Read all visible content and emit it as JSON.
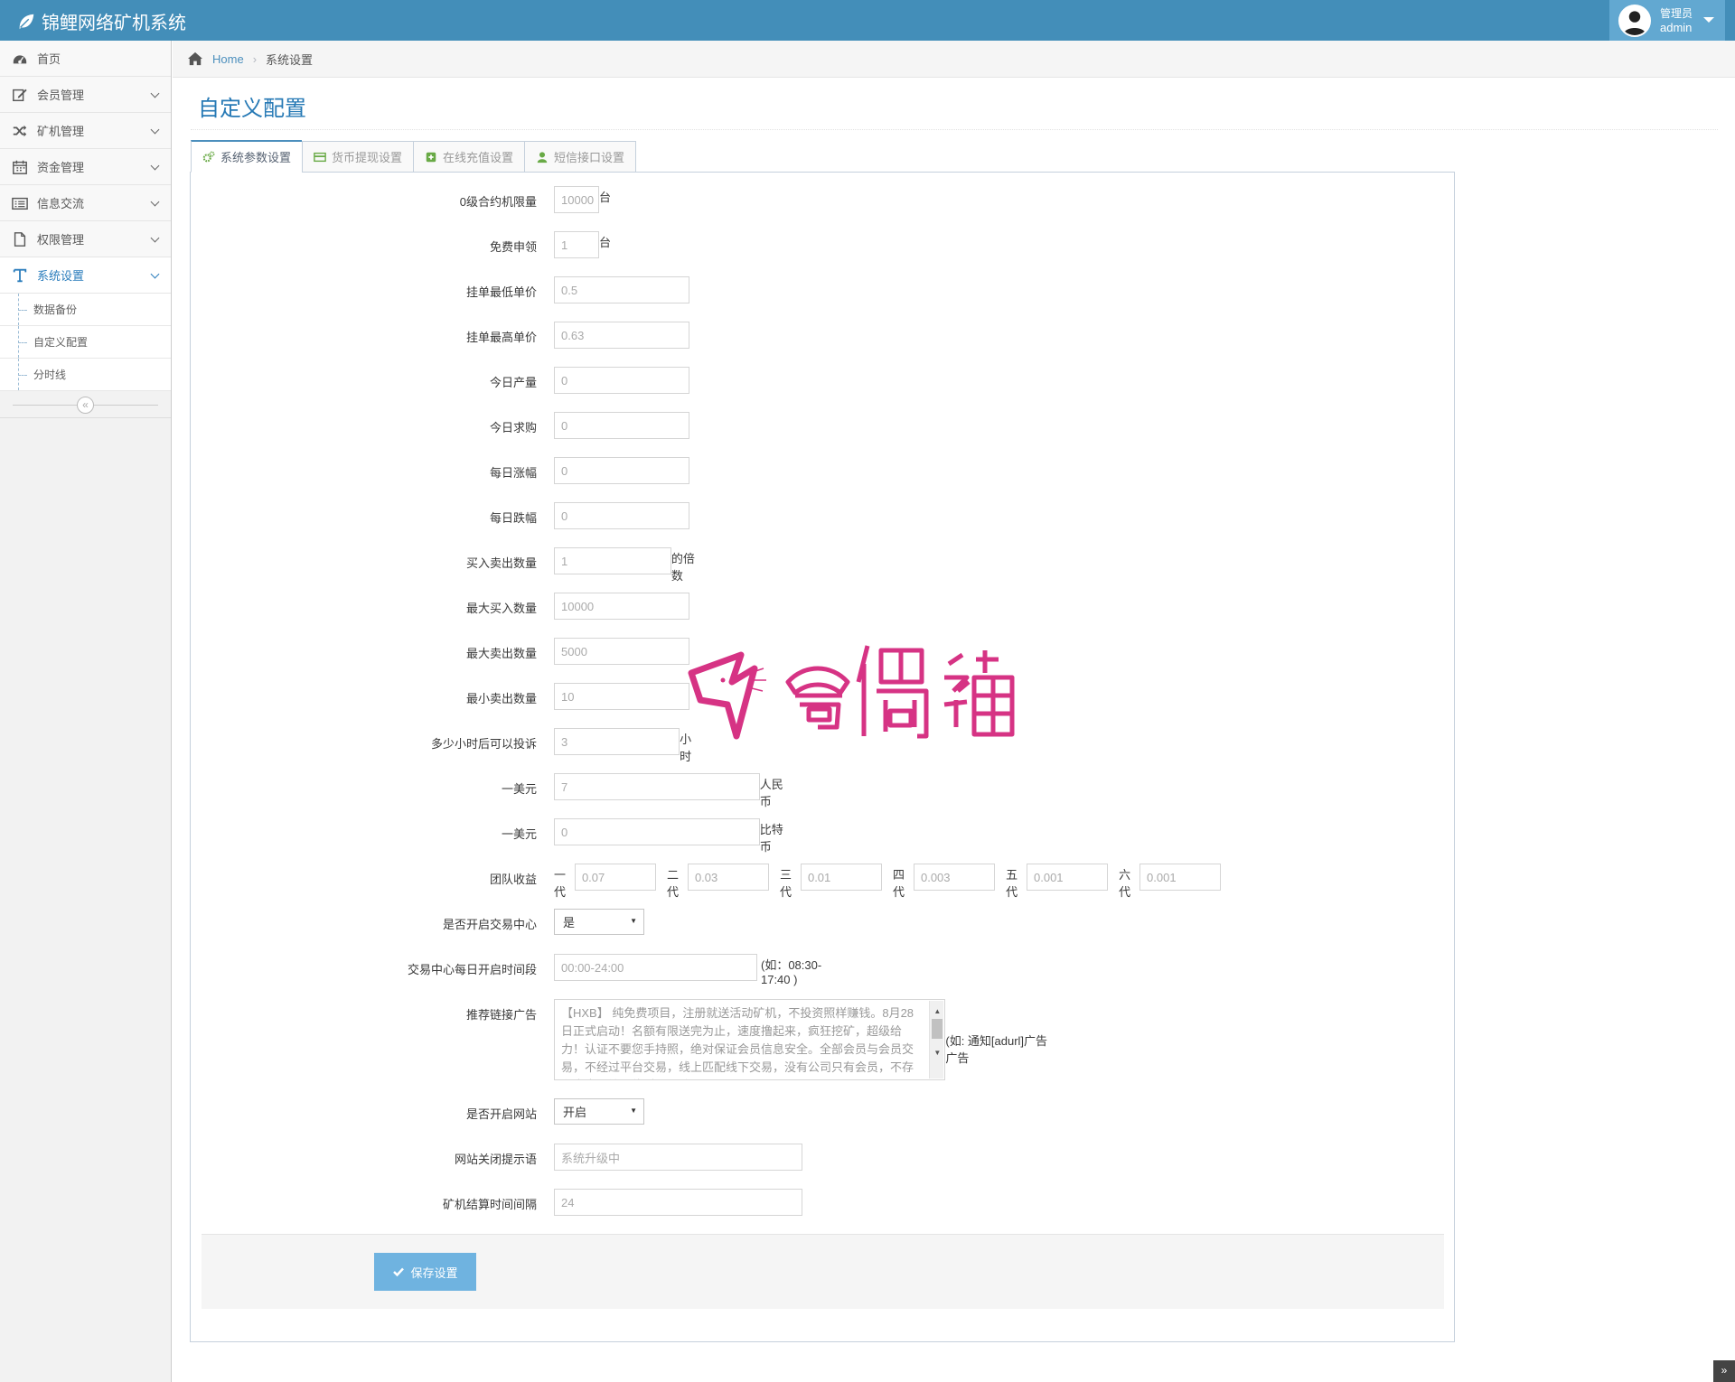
{
  "app": {
    "title": "锦鲤网络矿机系统"
  },
  "user": {
    "role": "管理员",
    "name": "admin"
  },
  "sidebar": {
    "items": [
      {
        "label": "首页"
      },
      {
        "label": "会员管理"
      },
      {
        "label": "矿机管理"
      },
      {
        "label": "资金管理"
      },
      {
        "label": "信息交流"
      },
      {
        "label": "权限管理"
      },
      {
        "label": "系统设置"
      }
    ],
    "sub_items": [
      {
        "label": "数据备份"
      },
      {
        "label": "自定义配置"
      },
      {
        "label": "分时线"
      }
    ]
  },
  "breadcrumb": {
    "home": "Home",
    "current": "系统设置"
  },
  "page": {
    "title": "自定义配置"
  },
  "tabs": [
    {
      "label": "系统参数设置"
    },
    {
      "label": "货币提现设置"
    },
    {
      "label": "在线充值设置"
    },
    {
      "label": "短信接口设置"
    }
  ],
  "form": {
    "level0_limit": {
      "label": "0级合约机限量",
      "value": "10000",
      "suffix": "台"
    },
    "free_claim": {
      "label": "免费申领",
      "value": "1",
      "suffix": "台"
    },
    "min_price": {
      "label": "挂单最低单价",
      "value": "0.5"
    },
    "max_price": {
      "label": "挂单最高单价",
      "value": "0.63"
    },
    "today_output": {
      "label": "今日产量",
      "value": "0"
    },
    "today_buy": {
      "label": "今日求购",
      "value": "0"
    },
    "daily_rise": {
      "label": "每日涨幅",
      "value": "0"
    },
    "daily_fall": {
      "label": "每日跌幅",
      "value": "0"
    },
    "trade_qty": {
      "label": "买入卖出数量",
      "value": "1",
      "suffix": "的倍数"
    },
    "max_buy": {
      "label": "最大买入数量",
      "value": "10000"
    },
    "max_sell": {
      "label": "最大卖出数量",
      "value": "5000"
    },
    "min_sell": {
      "label": "最小卖出数量",
      "value": "10"
    },
    "complaint_hours": {
      "label": "多少小时后可以投诉",
      "value": "3",
      "suffix": "小时"
    },
    "usd_cny": {
      "label": "一美元",
      "value": "7",
      "suffix": "人民币"
    },
    "usd_btc": {
      "label": "一美元",
      "value": "0",
      "suffix": "比特币"
    },
    "team_income": {
      "label": "团队收益",
      "levels": [
        {
          "gen": "一代",
          "value": "0.07"
        },
        {
          "gen": "二代",
          "value": "0.03"
        },
        {
          "gen": "三代",
          "value": "0.01"
        },
        {
          "gen": "四代",
          "value": "0.003"
        },
        {
          "gen": "五代",
          "value": "0.001"
        },
        {
          "gen": "六代",
          "value": "0.001"
        }
      ]
    },
    "trade_center": {
      "label": "是否开启交易中心",
      "value": "是"
    },
    "trade_hours": {
      "label": "交易中心每日开启时间段",
      "value": "00:00-24:00",
      "hint": "(如：08:30-17:40 )"
    },
    "ad": {
      "label": "推荐链接广告",
      "value": "【HXB】 纯免费项目，注册就送活动矿机，不投资照样赚钱。8月28日正式启动！名额有限送完为止，速度撸起来，疯狂挖矿，超级给力！认证不要您手持照，绝对保证会员信息安全。全部会员与会员交易，不经过平台交易，线上匹配线下交易，没有公司只有会员，不存在崩盘圈钱，绝对零风险！",
      "hint": "(如: 通知[adurl]广告广告"
    },
    "site_open": {
      "label": "是否开启网站",
      "value": "开启"
    },
    "close_msg": {
      "label": "网站关闭提示语",
      "placeholder": "系统升级中"
    },
    "settle_interval": {
      "label": "矿机结算时间间隔",
      "value": "24"
    },
    "save_label": "保存设置"
  },
  "colors": {
    "navbar": "#438eb9",
    "accent": "#2679b5",
    "button": "#6fb3e0"
  }
}
